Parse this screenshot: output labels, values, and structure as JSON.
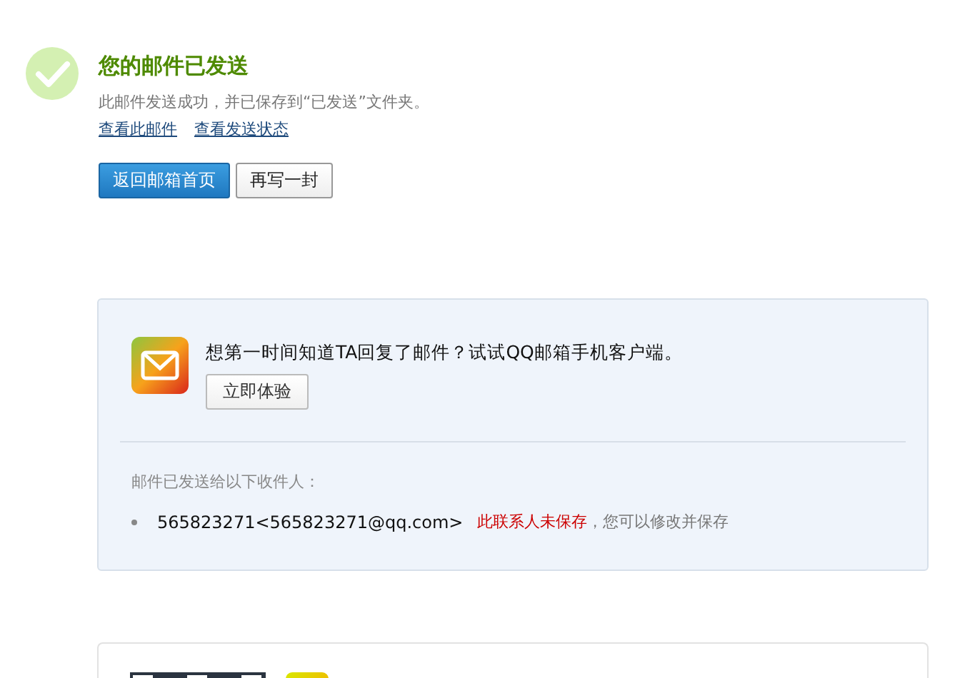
{
  "status": {
    "title": "您的邮件已发送",
    "message": "此邮件发送成功，并已保存到“已发送”文件夹。",
    "links": [
      "查看此邮件",
      "查看发送状态"
    ],
    "buttons": [
      {
        "label": "返回邮箱首页",
        "kind": "primary"
      },
      {
        "label": "再写一封",
        "kind": "secondary"
      }
    ]
  },
  "promo": {
    "text": "想第一时间知道TA回复了邮件？试试QQ邮箱手机客户端。",
    "button": "立即体验"
  },
  "recipients": {
    "heading": "邮件已发送给以下收件人：",
    "items": [
      {
        "address": "565823271<565823271@qq.com>",
        "warning": "此联系人未保存",
        "hint": "，您可以修改并保存"
      }
    ]
  }
}
